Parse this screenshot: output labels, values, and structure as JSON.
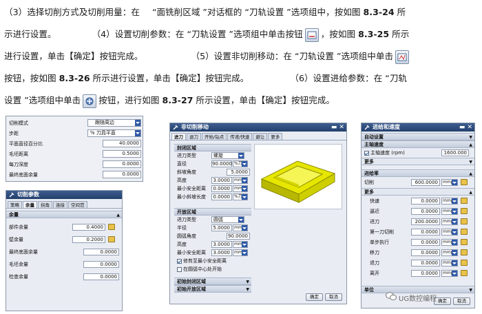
{
  "text": {
    "line1_a": "（3）选择切削方式及切削用量：在 ",
    "line1_b": "“面铣削区域 ”对话框的 “刀轨设置 ”选项组中，按如图 ",
    "line1_fig": "8.3-24",
    "line1_c": " 所",
    "line2_a": "示进行设置。",
    "line2_b": "（4）设置切削参数：在 “刀轨设置 ”选项组中单击按钮",
    "line2_c": "，按如图 ",
    "line2_fig": "8.3-25",
    "line2_d": " 所示",
    "line3_a": "进行设置，单击【确定】按钮完成。",
    "line3_b": "（5）设置非切削移动：在 “刀轨设置 ”选项组中单击",
    "line4_a": "按钮，按如图 ",
    "line4_fig": "8.3-26",
    "line4_b": " 所示进行设置，单击【确定】按钮完成。",
    "line4_c": "（6）设置进给参数：在 “刀轨",
    "line5_a": "设置 ”选项组中单击",
    "line5_b": "按钮，进行如图 ",
    "line5_fig": "8.3-27",
    "line5_c": " 所示设置，单击【确定】按钮完成。"
  },
  "fig24": {
    "rows": [
      {
        "label": "切削模式",
        "value": "跟随周边"
      },
      {
        "label": "步距",
        "value": "% 刀具平直"
      },
      {
        "label": "平面直径百分比",
        "value": "40.0000"
      },
      {
        "label": "毛坯距离",
        "value": "0.5000"
      },
      {
        "label": "每刀深度",
        "value": "0.0000"
      },
      {
        "label": "最终底面余量",
        "value": "0.0000"
      }
    ]
  },
  "fig25": {
    "title": "切削参数",
    "tabs": [
      "策略",
      "余量",
      "拐角",
      "连接",
      "空间范"
    ],
    "section": "余量",
    "rows": [
      {
        "label": "部件余量",
        "value": "0.4000"
      },
      {
        "label": "壁余量",
        "value": "0.2000"
      },
      {
        "label": "最终底面余量",
        "value": "0.0000"
      },
      {
        "label": "毛坯余量",
        "value": "0.0000"
      },
      {
        "label": "检查余量",
        "value": "0.0000"
      }
    ]
  },
  "fig26": {
    "title": "非切削移动",
    "tabs": [
      "进刀",
      "退刀",
      "开始/钻点",
      "传递/快速",
      "避让",
      "更多"
    ],
    "section1": "封闭区域",
    "s1rows": [
      {
        "label": "进刀类型",
        "value": "螺旋",
        "unit": ""
      },
      {
        "label": "直径",
        "value": "90.0000",
        "unit": "%刀具"
      },
      {
        "label": "斜坡角度",
        "value": "5.0000",
        "unit": ""
      },
      {
        "label": "高度",
        "value": "3.0000",
        "unit": "mm"
      },
      {
        "label": "最小安全距离",
        "value": "0.0000",
        "unit": "mm"
      },
      {
        "label": "最小斜坡长度",
        "value": "0.0000",
        "unit": "%刀具"
      }
    ],
    "section2": "开放区域",
    "s2rows": [
      {
        "label": "进刀类型",
        "value": "圆弧",
        "unit": ""
      },
      {
        "label": "半径",
        "value": "5.0000",
        "unit": "mm"
      },
      {
        "label": "圆弧角度",
        "value": "90.0000",
        "unit": ""
      },
      {
        "label": "高度",
        "value": "3.0000",
        "unit": "mm"
      },
      {
        "label": "最小安全距离",
        "value": "3.0000",
        "unit": "mm"
      }
    ],
    "check1": "修剪至最小安全距离",
    "check2": "在圆弧中心处开始",
    "section3": "初始封闭区域",
    "section4": "初始开放区域",
    "ok": "确定",
    "cancel": "取消"
  },
  "fig27": {
    "title": "进给和速度",
    "auto": "自动设置",
    "spindle_sec": "主轴速度",
    "spindle_label": "主轴速度 (rpm)",
    "spindle_value": "1600.000",
    "more": "更多",
    "feed_sec": "进给率",
    "cut_label": "切削",
    "cut_value": "600.0000",
    "cut_unit": "mmpr",
    "more2": "更多",
    "rows": [
      {
        "label": "快速",
        "value": "0.0000",
        "unit": "mmpr"
      },
      {
        "label": "逼近",
        "value": "0.0000",
        "unit": "mmpr"
      },
      {
        "label": "进刀",
        "value": "200.0000",
        "unit": "mmpr"
      },
      {
        "label": "第一刀切削",
        "value": "0.0000",
        "unit": "mmpr"
      },
      {
        "label": "单步执行",
        "value": "0.0000",
        "unit": "mmpr"
      },
      {
        "label": "移刀",
        "value": "0.0000",
        "unit": "mmpr"
      },
      {
        "label": "退刀",
        "value": "0.0000",
        "unit": "mmpr"
      },
      {
        "label": "离开",
        "value": "0.0000",
        "unit": "mmpr"
      }
    ],
    "unit_sec": "单位",
    "ok": "确定",
    "cancel": "取消"
  },
  "watermark": "UG数控编程"
}
